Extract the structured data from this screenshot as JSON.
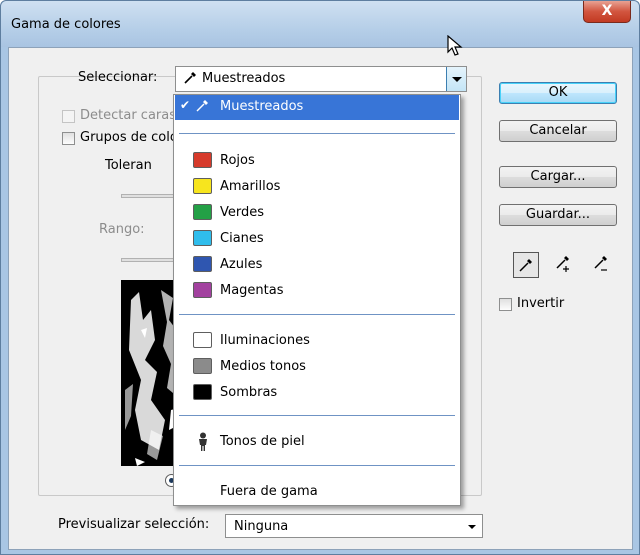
{
  "window": {
    "title": "Gama de colores",
    "close_label": "X"
  },
  "select": {
    "label": "Seleccionar:",
    "value": "Muestreados"
  },
  "options": {
    "detect_faces": "Detectar caras",
    "color_groups": "Grupos de colo",
    "tolerance": "Toleran",
    "range": "Rango:"
  },
  "buttons": {
    "ok": "OK",
    "cancel": "Cancelar",
    "load": "Cargar...",
    "save": "Guardar..."
  },
  "invert": "Invertir",
  "preview": {
    "label": "Previsualizar selección:",
    "value": "Ninguna"
  },
  "menu": {
    "items": [
      {
        "label": "Muestreados",
        "selected": true
      },
      {
        "label": "Rojos",
        "color": "#d63a2b"
      },
      {
        "label": "Amarillos",
        "color": "#f7e51e"
      },
      {
        "label": "Verdes",
        "color": "#23a046"
      },
      {
        "label": "Cianes",
        "color": "#2fbdec"
      },
      {
        "label": "Azules",
        "color": "#2f56b0"
      },
      {
        "label": "Magentas",
        "color": "#a2419f"
      },
      {
        "label": "Iluminaciones",
        "color": "#ffffff"
      },
      {
        "label": "Medios tonos",
        "color": "#8b8b8b"
      },
      {
        "label": "Sombras",
        "color": "#000000"
      },
      {
        "label": "Tonos de piel"
      },
      {
        "label": "Fuera de gama"
      }
    ]
  },
  "colors": {
    "highlight": "#3875d7",
    "separator": "#6f93c4"
  }
}
